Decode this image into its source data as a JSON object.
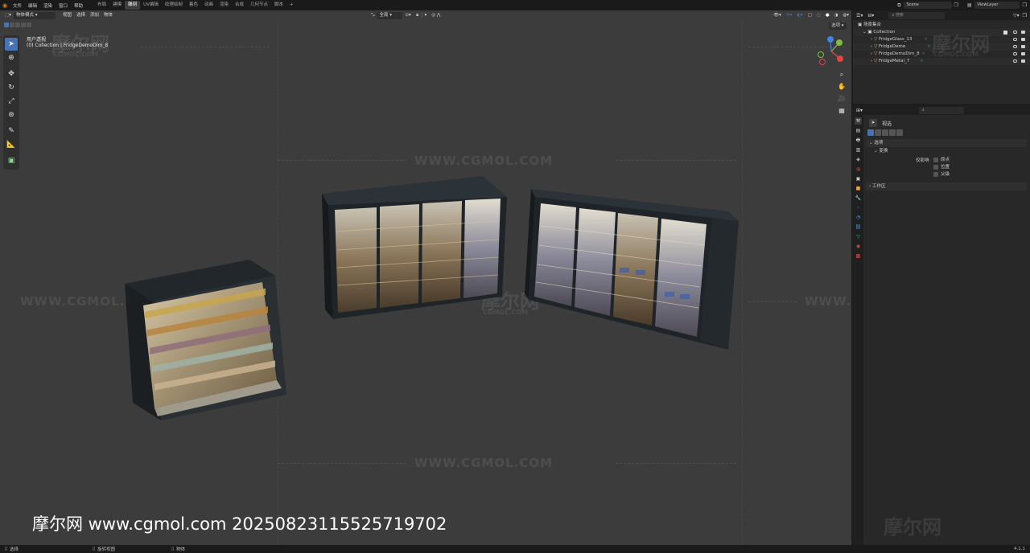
{
  "menubar": {
    "items": [
      "文件",
      "编辑",
      "渲染",
      "窗口",
      "帮助"
    ],
    "workspaces": [
      "布局",
      "建模",
      "雕刻",
      "UV编辑",
      "纹理绘制",
      "着色",
      "动画",
      "渲染",
      "合成",
      "几何节点",
      "脚本"
    ],
    "active_workspace": "雕刻",
    "add_tab": "+",
    "scene": "Scene",
    "view_layer": "ViewLayer"
  },
  "viewport": {
    "mode": "物体模式",
    "menus": [
      "视图",
      "选择",
      "添加",
      "物体"
    ],
    "transform_orientation": "全局",
    "view_name": "用户透视",
    "collection_info": "(0) Collection | FridgeDemoDim_8",
    "options_label": "选项"
  },
  "outliner": {
    "search_placeholder": "搜索",
    "scene_collection": "场景集合",
    "collection": "Collection",
    "objects": [
      "FridgeGlass_13",
      "FridgeDemo",
      "FridgeDemoDim_8",
      "FridgeMetal_7"
    ]
  },
  "properties": {
    "search_placeholder": "",
    "context_label": "视选",
    "section_options": "选项",
    "section_transform": "变换",
    "affect_only_label": "仅影响",
    "affect_options": [
      "原点",
      "位置",
      "父级"
    ],
    "section_workspace": "工作区"
  },
  "statusbar": {
    "left": "选择",
    "middle": "旋转视图",
    "right_menu": "物体",
    "version": "4.1.1"
  },
  "watermark": {
    "url": "WWW.CGMOL.COM",
    "brand": "摩尔网",
    "brand_sub": "CGMOL.COM",
    "bottom_text": "摩尔网 www.cgmol.com 20250823115525719702"
  },
  "colors": {
    "accent": "#4772b3",
    "viewport_bg": "#3c3c3c",
    "panel_bg": "#282828",
    "header_bg": "#1a1a1a",
    "x_axis": "#e0453f",
    "y_axis": "#7fbf3f",
    "z_axis": "#3f84e0"
  }
}
